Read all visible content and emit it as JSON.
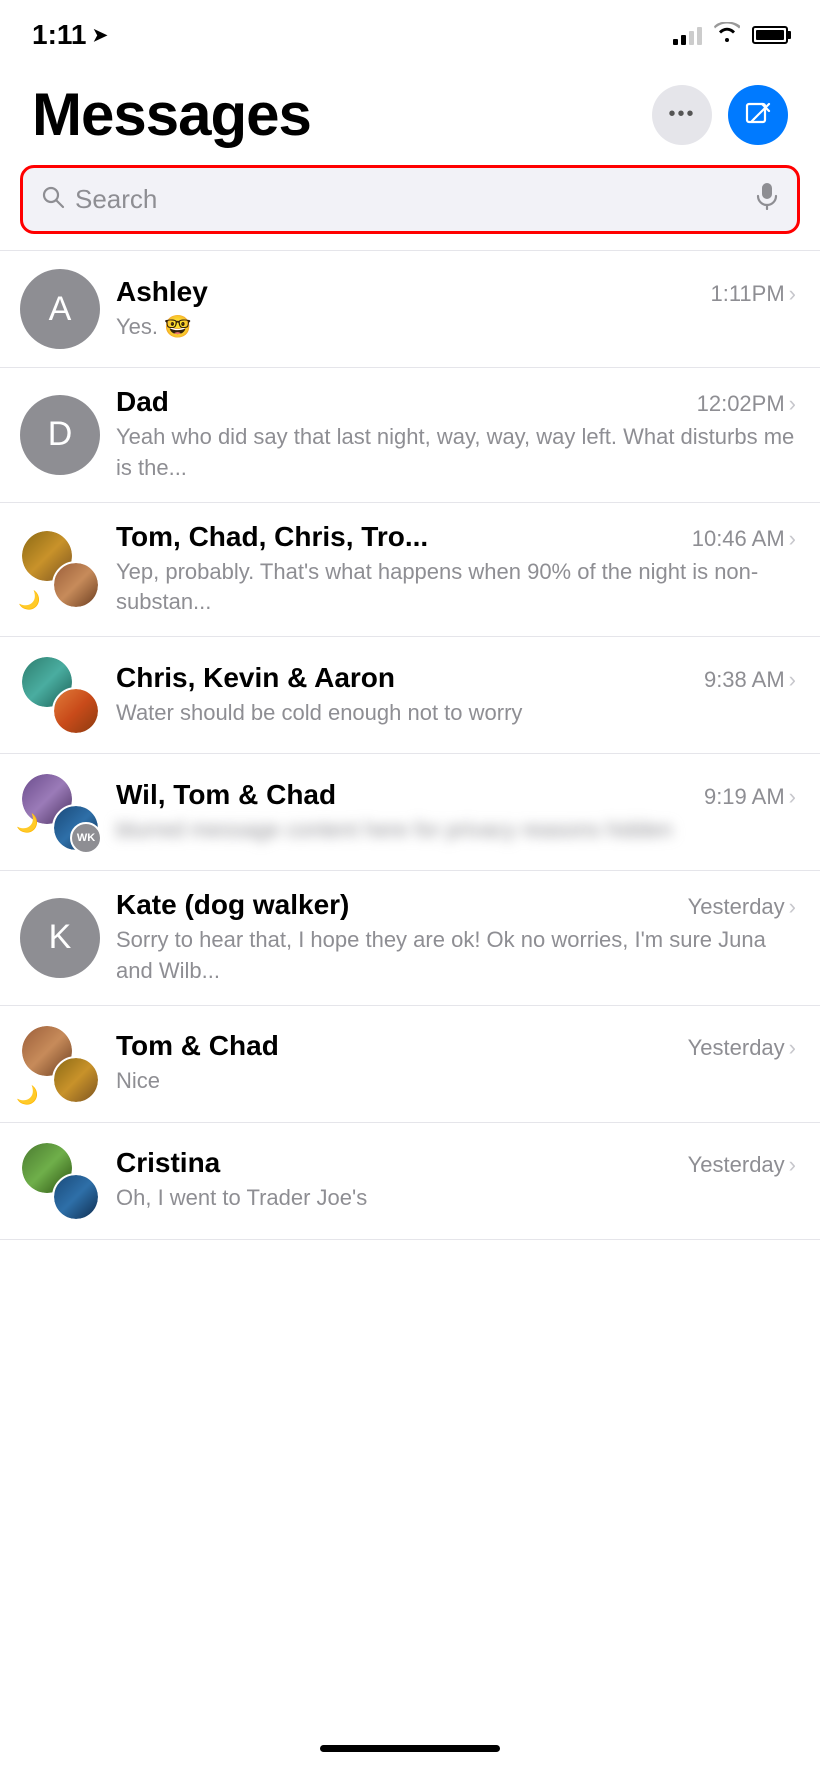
{
  "statusBar": {
    "time": "1:11",
    "locationArrow": "➤",
    "battery": "full"
  },
  "header": {
    "title": "Messages",
    "moreButton": "···",
    "composeButton": "✎"
  },
  "search": {
    "placeholder": "Search",
    "micIcon": "🎙"
  },
  "conversations": [
    {
      "id": 1,
      "name": "Ashley",
      "time": "1:11PM",
      "preview": "Yes. 🤓",
      "avatarType": "letter",
      "avatarLetter": "A",
      "avatarColor": "gray",
      "muted": false,
      "blurred": false
    },
    {
      "id": 2,
      "name": "Dad",
      "time": "12:02PM",
      "preview": "Yeah who did say that last night, way, way, way left. What disturbs me is the...",
      "avatarType": "letter",
      "avatarLetter": "D",
      "avatarColor": "gray",
      "muted": false,
      "blurred": false
    },
    {
      "id": 3,
      "name": "Tom, Chad, Chris, Tro...",
      "time": "10:46 AM",
      "preview": "Yep, probably. That's what happens when 90% of the night is non-substan...",
      "avatarType": "group",
      "muted": true,
      "blurred": false
    },
    {
      "id": 4,
      "name": "Chris, Kevin & Aaron",
      "time": "9:38 AM",
      "preview": "Water should be cold enough not to worry",
      "avatarType": "group2",
      "muted": false,
      "blurred": false
    },
    {
      "id": 5,
      "name": "Wil, Tom & Chad",
      "time": "9:19 AM",
      "preview": "blurred message content here for privacy",
      "avatarType": "group3",
      "muted": true,
      "blurred": true,
      "badgeText": "WK"
    },
    {
      "id": 6,
      "name": "Kate (dog walker)",
      "time": "Yesterday",
      "preview": "Sorry to hear that, I hope they are ok! Ok no worries, I'm sure Juna and Wilb...",
      "avatarType": "letter",
      "avatarLetter": "K",
      "avatarColor": "gray",
      "muted": false,
      "blurred": false
    },
    {
      "id": 7,
      "name": "Tom & Chad",
      "time": "Yesterday",
      "preview": "Nice",
      "avatarType": "group4",
      "muted": true,
      "blurred": false
    },
    {
      "id": 8,
      "name": "Cristina",
      "time": "Yesterday",
      "preview": "Oh, I went to Trader Joe's",
      "avatarType": "group5",
      "muted": false,
      "blurred": false
    }
  ],
  "homeIndicator": "—"
}
